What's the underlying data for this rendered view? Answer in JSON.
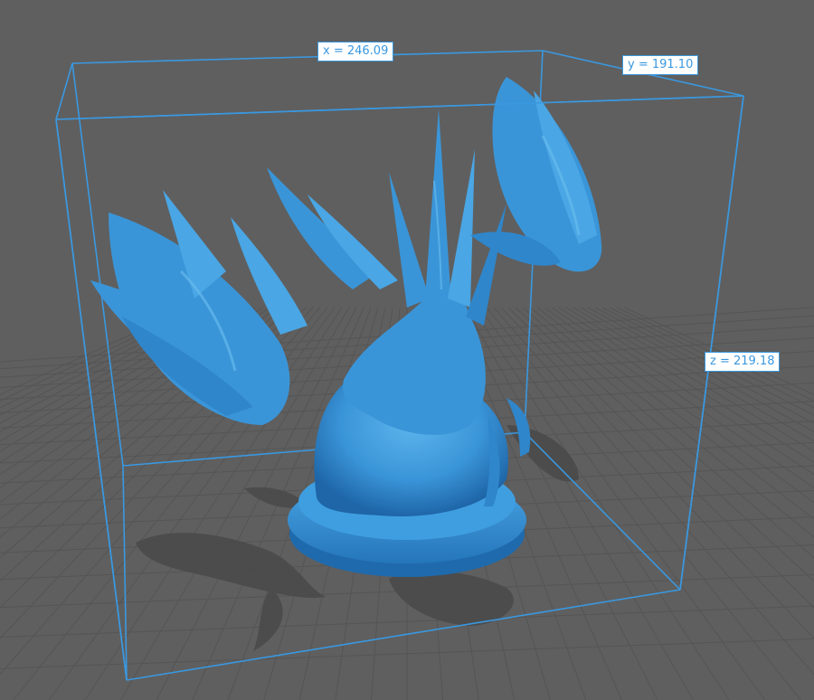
{
  "viewport": {
    "background_color": "#5f5f5f",
    "grid_color": "#555555",
    "grid_minor_color": "#595959",
    "bounding_box_color": "#3a98e0",
    "model_color": "#3a95d8",
    "model_highlight_color": "#5db4ec",
    "model_shadow_color": "#1e66a8",
    "shadow_color": "#4a4a4a"
  },
  "model": {
    "description_icon": "dragon-miniature-model"
  },
  "dimensions": {
    "x_label": "x = 246.09",
    "y_label": "y = 191.10",
    "z_label": "z = 219.18"
  }
}
